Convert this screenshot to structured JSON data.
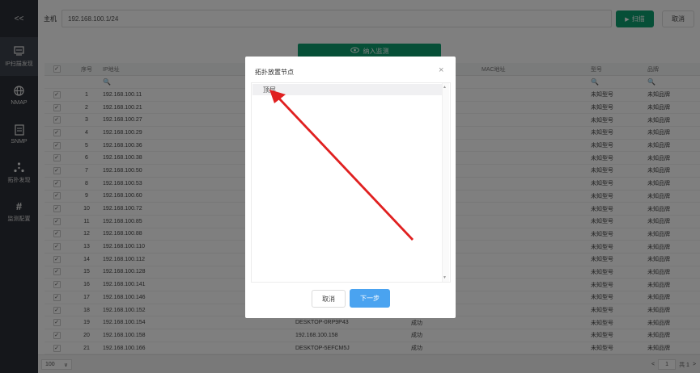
{
  "sidebar": {
    "collapse_label": "<<",
    "items": [
      {
        "label": "IP扫描发现",
        "icon": "monitor-icon"
      },
      {
        "label": "NMAP",
        "icon": "globe-icon"
      },
      {
        "label": "SNMP",
        "icon": "document-icon"
      },
      {
        "label": "拓扑发现",
        "icon": "topology-icon"
      },
      {
        "label": "监测配置",
        "icon": "hash-icon"
      }
    ]
  },
  "topbar": {
    "host_label": "主机",
    "host_value": "192.168.100.1/24",
    "scan_label": "扫描",
    "scan_icon": "▶",
    "cancel_label": "取消"
  },
  "add_monitor": {
    "label": "纳入监测",
    "icon": "eye-icon"
  },
  "table": {
    "headers": {
      "no": "序号",
      "ip": "IP地址",
      "mac": "MAC地址",
      "model": "型号",
      "brand": "品牌"
    },
    "filter_icon": "🔍",
    "rows": [
      {
        "no": "1",
        "ip": "192.168.100.11",
        "name": "",
        "status": "",
        "model": "未知型号",
        "brand": "未知品牌"
      },
      {
        "no": "2",
        "ip": "192.168.100.21",
        "name": "",
        "status": "",
        "model": "未知型号",
        "brand": "未知品牌"
      },
      {
        "no": "3",
        "ip": "192.168.100.27",
        "name": "",
        "status": "",
        "model": "未知型号",
        "brand": "未知品牌"
      },
      {
        "no": "4",
        "ip": "192.168.100.29",
        "name": "",
        "status": "",
        "model": "未知型号",
        "brand": "未知品牌"
      },
      {
        "no": "5",
        "ip": "192.168.100.36",
        "name": "",
        "status": "",
        "model": "未知型号",
        "brand": "未知品牌"
      },
      {
        "no": "6",
        "ip": "192.168.100.38",
        "name": "",
        "status": "",
        "model": "未知型号",
        "brand": "未知品牌"
      },
      {
        "no": "7",
        "ip": "192.168.100.50",
        "name": "",
        "status": "",
        "model": "未知型号",
        "brand": "未知品牌"
      },
      {
        "no": "8",
        "ip": "192.168.100.53",
        "name": "",
        "status": "",
        "model": "未知型号",
        "brand": "未知品牌"
      },
      {
        "no": "9",
        "ip": "192.168.100.60",
        "name": "",
        "status": "",
        "model": "未知型号",
        "brand": "未知品牌"
      },
      {
        "no": "10",
        "ip": "192.168.100.72",
        "name": "",
        "status": "",
        "model": "未知型号",
        "brand": "未知品牌"
      },
      {
        "no": "11",
        "ip": "192.168.100.85",
        "name": "",
        "status": "",
        "model": "未知型号",
        "brand": "未知品牌"
      },
      {
        "no": "12",
        "ip": "192.168.100.88",
        "name": "",
        "status": "",
        "model": "未知型号",
        "brand": "未知品牌"
      },
      {
        "no": "13",
        "ip": "192.168.100.110",
        "name": "",
        "status": "",
        "model": "未知型号",
        "brand": "未知品牌"
      },
      {
        "no": "14",
        "ip": "192.168.100.112",
        "name": "",
        "status": "",
        "model": "未知型号",
        "brand": "未知品牌"
      },
      {
        "no": "15",
        "ip": "192.168.100.128",
        "name": "",
        "status": "",
        "model": "未知型号",
        "brand": "未知品牌"
      },
      {
        "no": "16",
        "ip": "192.168.100.141",
        "name": "",
        "status": "",
        "model": "未知型号",
        "brand": "未知品牌"
      },
      {
        "no": "17",
        "ip": "192.168.100.146",
        "name": "",
        "status": "",
        "model": "未知型号",
        "brand": "未知品牌"
      },
      {
        "no": "18",
        "ip": "192.168.100.152",
        "name": "",
        "status": "",
        "model": "未知型号",
        "brand": "未知品牌"
      },
      {
        "no": "19",
        "ip": "192.168.100.154",
        "name": "DESKTOP-0RP9P43",
        "status": "成功",
        "model": "未知型号",
        "brand": "未知品牌"
      },
      {
        "no": "20",
        "ip": "192.168.100.158",
        "name": "192.168.100.158",
        "status": "成功",
        "model": "未知型号",
        "brand": "未知品牌"
      },
      {
        "no": "21",
        "ip": "192.168.100.166",
        "name": "DESKTOP-5EFCM5J",
        "status": "成功",
        "model": "未知型号",
        "brand": "未知品牌"
      }
    ]
  },
  "footer": {
    "page_size": "100",
    "page_size_arrow": "∨",
    "prev": "<",
    "current_page": "1",
    "total": "共 1",
    "next": ">"
  },
  "modal": {
    "title": "拓扑放置节点",
    "close": "×",
    "tree_root": "顶层",
    "scroll_up": "▲",
    "scroll_down": "▼",
    "cancel_label": "取消",
    "next_label": "下一步"
  },
  "colors": {
    "sidebar_bg": "#2b2f36",
    "primary_green": "#0c9f6e",
    "primary_blue": "#4aa3f0",
    "annotation_red": "#e02020"
  }
}
